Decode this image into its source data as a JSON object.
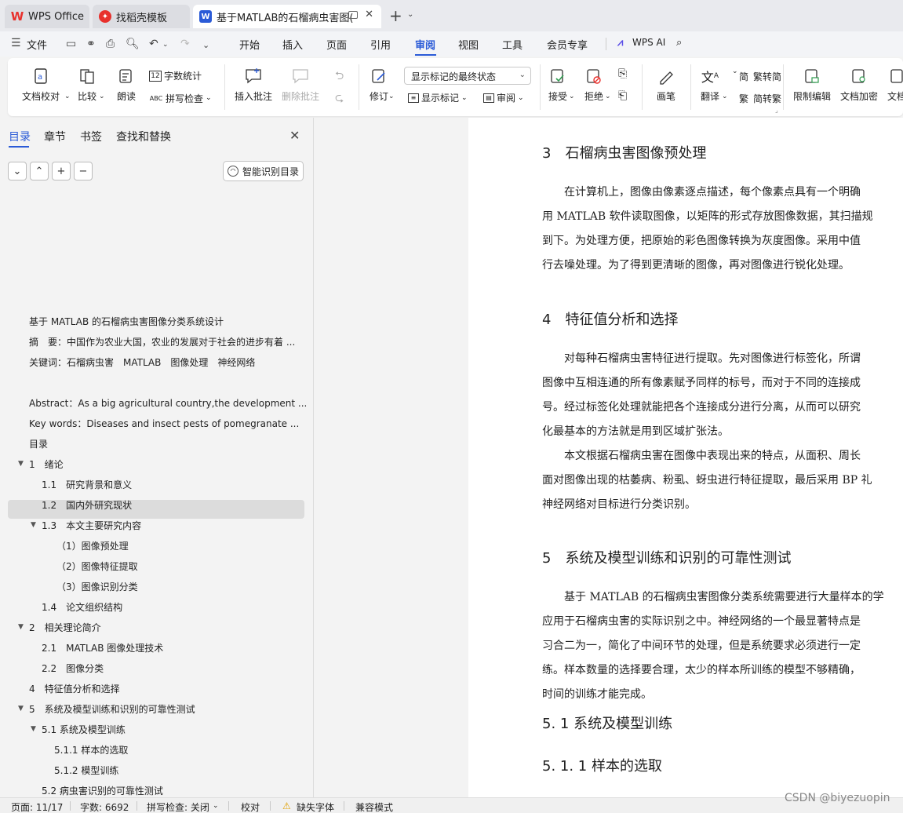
{
  "colors": {
    "accent": "#2b5bd7",
    "wps_red": "#e8302c",
    "doc_blue": "#2b5bd7"
  },
  "tabs": [
    {
      "label": "WPS Office",
      "icon": "wps-logo-icon"
    },
    {
      "label": "找稻壳模板",
      "icon": "docer-icon"
    },
    {
      "label": "基于MATLAB的石榴病虫害图(",
      "icon": "writer-doc-icon"
    }
  ],
  "menu": {
    "file_label": "文件",
    "items": [
      "开始",
      "插入",
      "页面",
      "引用",
      "审阅",
      "视图",
      "工具",
      "会员专享"
    ],
    "active": "审阅",
    "ai_label": "WPS AI"
  },
  "ribbon": {
    "doc_check": "文档校对",
    "compare": "比较",
    "read_aloud": "朗读",
    "word_count": "字数统计",
    "spell_check": "拼写检查",
    "insert_comment": "插入批注",
    "delete_comment": "删除批注",
    "revise": "修订",
    "markup_state": "显示标记的最终状态",
    "show_markup": "显示标记",
    "review": "审阅",
    "accept": "接受",
    "reject": "拒绝",
    "pen": "画笔",
    "translate": "翻译",
    "to_simplified": "繁转简",
    "to_traditional": "简转繁",
    "restrict_edit": "限制编辑",
    "encrypt": "文档加密",
    "more": "文档"
  },
  "nav": {
    "tabs": [
      "目录",
      "章节",
      "书签",
      "查找和替换"
    ],
    "smart_toc": "智能识别目录",
    "toc": [
      {
        "label": "基于 MATLAB 的石榴病虫害图像分类系统设计",
        "level": 0,
        "arrow": false
      },
      {
        "label": "摘　要：中国作为农业大国，农业的发展对于社会的进步有着 ...",
        "level": 0,
        "arrow": false
      },
      {
        "label": "关键词：石榴病虫害　MATLAB　图像处理　神经网络",
        "level": 0,
        "arrow": false
      },
      {
        "label": "Abstract：As a big agricultural country,the development  ...",
        "level": 0,
        "arrow": false
      },
      {
        "label": "Key words：Diseases and insect pests of pomegranate    ...",
        "level": 0,
        "arrow": false
      },
      {
        "label": "目录",
        "level": 0,
        "arrow": false
      },
      {
        "label": "1　绪论",
        "level": 0,
        "arrow": true
      },
      {
        "label": "1.1　研究背景和意义",
        "level": 1,
        "arrow": false
      },
      {
        "label": "1.2　国内外研究现状",
        "level": 1,
        "arrow": false
      },
      {
        "label": "1.3　本文主要研究内容",
        "level": 1,
        "arrow": true
      },
      {
        "label": "（1）图像预处理",
        "level": 2,
        "arrow": false
      },
      {
        "label": "（2）图像特征提取",
        "level": 2,
        "arrow": false
      },
      {
        "label": "（3）图像识别分类",
        "level": 2,
        "arrow": false
      },
      {
        "label": "1.4　论文组织结构",
        "level": 1,
        "arrow": false
      },
      {
        "label": "2　相关理论简介",
        "level": 0,
        "arrow": true
      },
      {
        "label": "2.1　MATLAB 图像处理技术",
        "level": 1,
        "arrow": false
      },
      {
        "label": "2.2　图像分类",
        "level": 1,
        "arrow": false
      },
      {
        "label": "4　特征值分析和选择",
        "level": 0,
        "arrow": false
      },
      {
        "label": "5　系统及模型训练和识别的可靠性测试",
        "level": 0,
        "arrow": true
      },
      {
        "label": "5.1 系统及模型训练",
        "level": 1,
        "arrow": true
      },
      {
        "label": "5.1.1 样本的选取",
        "level": 2,
        "arrow": false
      },
      {
        "label": "5.1.2 模型训练",
        "level": 2,
        "arrow": false
      },
      {
        "label": "5.2 病虫害识别的可靠性测试",
        "level": 1,
        "arrow": false
      },
      {
        "label": "致　谢",
        "level": 0,
        "arrow": false
      }
    ]
  },
  "document": {
    "h3": "3　石榴病虫害图像预处理",
    "p3": [
      "　　在计算机上，图像由像素逐点描述，每个像素点具有一个明确",
      "用 MATLAB 软件读取图像，以矩阵的形式存放图像数据，其扫描规",
      "到下。为处理方便，把原始的彩色图像转换为灰度图像。采用中值",
      "行去噪处理。为了得到更清晰的图像，再对图像进行锐化处理。"
    ],
    "h4": "4　特征值分析和选择",
    "p4": [
      "　　对每种石榴病虫害特征进行提取。先对图像进行标签化，所谓",
      "图像中互相连通的所有像素赋予同样的标号，而对于不同的连接成",
      "号。经过标签化处理就能把各个连接成分进行分离，从而可以研究",
      "化最基本的方法就是用到区域扩张法。",
      "　　本文根据石榴病虫害在图像中表现出来的特点，从面积、周长",
      "面对图像出现的枯萎病、粉虱、蚜虫进行特征提取，最后采用 BP 礼",
      "神经网络对目标进行分类识别。"
    ],
    "h5": "5　系统及模型训练和识别的可靠性测试",
    "p5": [
      "　　基于 MATLAB 的石榴病虫害图像分类系统需要进行大量样本的学",
      "应用于石榴病虫害的实际识别之中。神经网络的一个最显著特点是",
      "习合二为一，简化了中间环节的处理，但是系统要求必须进行一定",
      "练。样本数量的选择要合理，太少的样本所训练的模型不够精确，",
      "时间的训练才能完成。"
    ],
    "h51": "5. 1 系统及模型训练",
    "h511": "5. 1. 1 样本的选取"
  },
  "status": {
    "page": "页面: 11/17",
    "words": "字数: 6692",
    "spell": "拼写检查: 关闭",
    "proof": "校对",
    "missing_font": "缺失字体",
    "compat": "兼容模式"
  },
  "watermark": "CSDN @biyezuopin"
}
